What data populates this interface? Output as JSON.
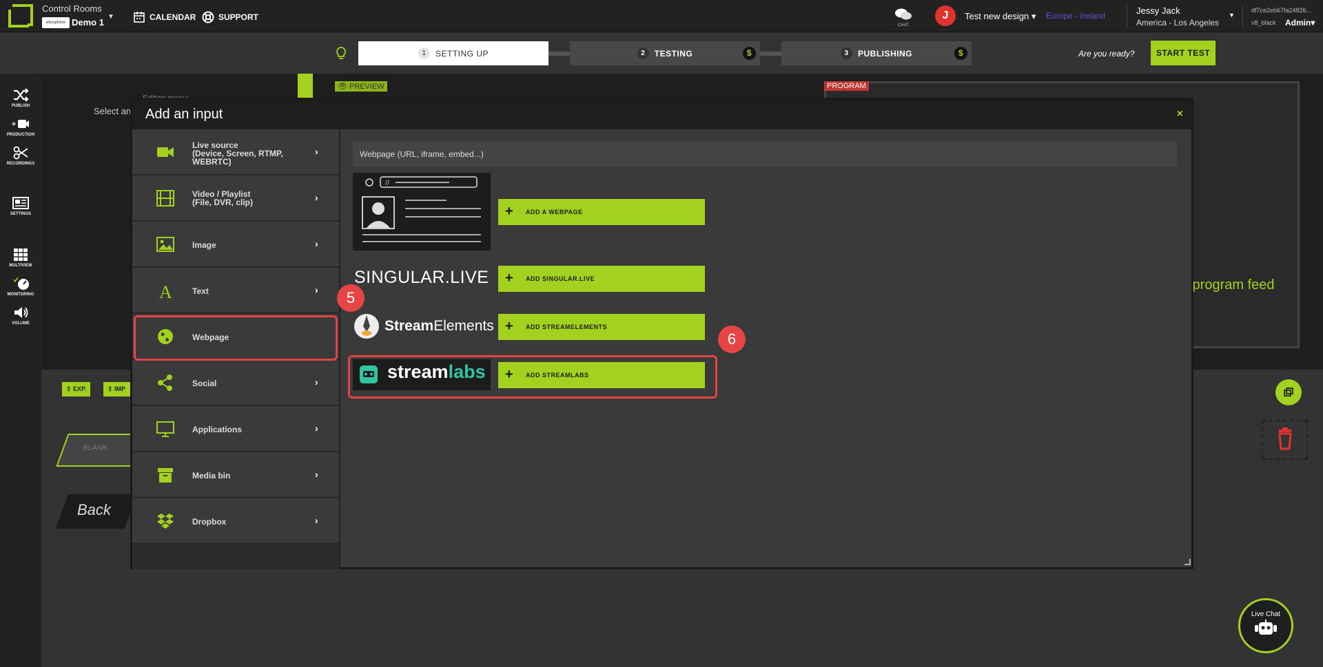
{
  "topbar": {
    "app_title": "Control Rooms",
    "brand_badge": "ekosphere",
    "room_name": "Demo 1",
    "calendar_label": "CALENDAR",
    "support_label": "SUPPORT",
    "chat_label": "CHAT",
    "avatar_initial": "J",
    "design_name": "Test new design",
    "region": "Europe - Ireland",
    "user_name": "Jessy Jack",
    "user_timezone": "America - Los Angeles",
    "session_id": "df7ce2eb67fa24826...",
    "theme": "v8_black",
    "role": "Admin"
  },
  "steps": [
    {
      "num": "1",
      "label": "SETTING UP"
    },
    {
      "num": "2",
      "label": "TESTING",
      "icon": "$"
    },
    {
      "num": "3",
      "label": "PUBLISHING",
      "icon": "$"
    }
  ],
  "ready_text": "Are you ready?",
  "start_test_label": "START TEST",
  "leftnav": [
    {
      "label": "PUBLISH"
    },
    {
      "label": "PRODUCTION"
    },
    {
      "label": "RECORDINGS"
    },
    {
      "label": "SETTINGS"
    },
    {
      "label": "MULTIVIEW"
    },
    {
      "label": "MONITORING"
    },
    {
      "label": "VOLUME"
    }
  ],
  "workspace": {
    "preview_label": "PREVIEW",
    "program_label": "PROGRAM",
    "program_feed_text": "/program feed",
    "select_text": "Select an",
    "edition_text": "Edition menu:",
    "exp_label": "EXP.",
    "imp_label": "IMP",
    "blank_label": "BLANK",
    "back_label": "Back",
    "live_chat_label": "Live Chat"
  },
  "modal": {
    "title": "Add an input",
    "close_icon": "×",
    "categories": [
      {
        "label": "Live source\n(Device, Screen, RTMP,\nWEBRTC)"
      },
      {
        "label": "Video / Playlist\n(File, DVR, clip)"
      },
      {
        "label": "Image"
      },
      {
        "label": "Text"
      },
      {
        "label": "Webpage"
      },
      {
        "label": "Social"
      },
      {
        "label": "Applications"
      },
      {
        "label": "Media bin"
      },
      {
        "label": "Dropbox"
      }
    ],
    "search_placeholder": "Webpage (URL, iframe, embed...)",
    "add_webpage_label": "ADD A WEBPAGE",
    "singular_logo": "SINGULAR.LIVE",
    "add_singular_label": "ADD SINGULAR.LIVE",
    "streamelements_logo": "StreamElements",
    "streamelements_logo_bold": "Stream",
    "streamelements_logo_rest": "Elements",
    "add_streamelements_label": "ADD STREAMELEMENTS",
    "streamlabs_logo_a": "stream",
    "streamlabs_logo_b": "labs",
    "add_streamlabs_label": "ADD STREAMLABS"
  },
  "annotations": {
    "badge_5": "5",
    "badge_6": "6"
  },
  "colors": {
    "accent": "#a3d11f",
    "highlight": "#e64545",
    "region": "#6b4fd8",
    "streamlabs": "#31c3a2"
  }
}
